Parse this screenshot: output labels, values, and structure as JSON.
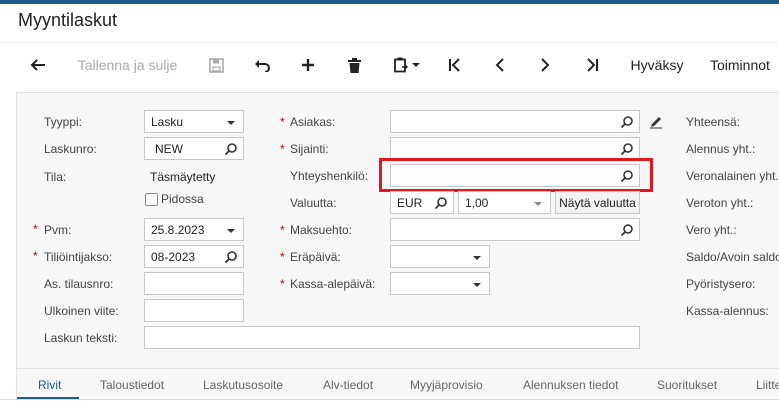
{
  "page": {
    "title": "Myyntilaskut"
  },
  "toolbar": {
    "save_close_label": "Tallenna ja sulje",
    "approve_label": "Hyväksy",
    "actions_label": "Toiminnot"
  },
  "form": {
    "tyyppi": {
      "label": "Tyyppi:",
      "value": "Lasku"
    },
    "laskunro": {
      "label": "Laskunro:",
      "value": "NEW"
    },
    "tila": {
      "label": "Tila:",
      "value": "Täsmäytetty"
    },
    "pidossa": {
      "label": "Pidossa",
      "checked": false
    },
    "pvm": {
      "label": "Pvm:",
      "value": "25.8.2023"
    },
    "tiliointijakso": {
      "label": "Tiliöintijakso:",
      "value": "08-2023"
    },
    "as_tilausnro": {
      "label": "As. tilausnro:",
      "value": ""
    },
    "ulkoinen_viite": {
      "label": "Ulkoinen viite:",
      "value": ""
    },
    "laskun_teksti": {
      "label": "Laskun teksti:",
      "value": ""
    },
    "asiakas": {
      "label": "Asiakas:",
      "value": ""
    },
    "sijainti": {
      "label": "Sijainti:",
      "value": ""
    },
    "yhteyshenkilo": {
      "label": "Yhteyshenkilö:",
      "value": ""
    },
    "valuutta": {
      "label": "Valuutta:",
      "currency": "EUR",
      "rate": "1,00",
      "button": "Näytä valuutta"
    },
    "maksuehto": {
      "label": "Maksuehto:",
      "value": ""
    },
    "erapaiva": {
      "label": "Eräpäivä:",
      "value": ""
    },
    "kassa_alepaiva": {
      "label": "Kassa-alepäivä:",
      "value": ""
    },
    "totals": {
      "yhteensa": "Yhteensä:",
      "alennus": "Alennus yht.:",
      "veronalainen": "Veronalainen yht.:",
      "veroton": "Veroton yht.:",
      "vero": "Vero yht.:",
      "saldo": "Saldo/Avoin saldo:",
      "pyoristysero": "Pyöristysero:",
      "kassa_alennus": "Kassa-alennus:"
    }
  },
  "tabs": [
    "Rivit",
    "Taloustiedot",
    "Laskutusosoite",
    "Alv-tiedot",
    "Myyjäprovisio",
    "Alennuksen tiedot",
    "Suoritukset",
    "Liitteet"
  ],
  "icons": [
    "back-arrow-icon",
    "save-icon",
    "undo-icon",
    "add-icon",
    "delete-icon",
    "clipboard-icon",
    "first-page-icon",
    "prev-page-icon",
    "next-page-icon",
    "last-page-icon",
    "search-icon",
    "chevron-down-icon",
    "edit-icon"
  ],
  "colors": {
    "brand": "#1f5b8e",
    "required": "#c00000",
    "highlight": "#e0191f"
  }
}
